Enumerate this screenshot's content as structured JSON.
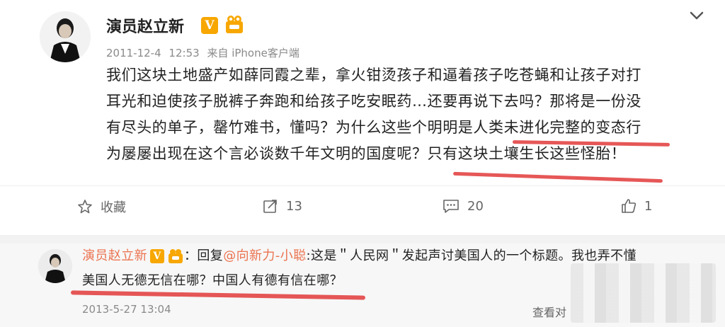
{
  "post": {
    "username": "演员赵立新",
    "verified_badge": "V",
    "level_icon": "level-badge-icon",
    "menu_icon": "chevron-down-icon",
    "date": "2011-12-4",
    "time": "12:53",
    "source": "来自 iPhone客户端",
    "content_lines": [
      "我们这块土地盛产如薛同霞之辈，拿火钳烫孩子和逼着孩子吃苍蝇和让孩子对打",
      "耳光和迫使孩子脱裤子奔跑和给孩子吃安眠药…还要再说下去吗？那将是一份没",
      "有尽头的单子，罄竹难书，懂吗？为什么这些个明明是人类未进化完整的变态行",
      "为屡屡出现在这个言必谈数千年文明的国度呢？只有这块土壤生长这些怪胎！"
    ],
    "highlight_color": "#e23a3a"
  },
  "actions": {
    "favorite_label": "收藏",
    "repost_count": "13",
    "comment_count": "20",
    "like_count": "1"
  },
  "comment": {
    "name": "演员赵立新",
    "verified_badge": "V",
    "separator": "：回复",
    "mention": "@向新力-小聪",
    "text_part1": ":这是＂人民网＂发起声讨美国人的一个标题。我也弄不懂",
    "text_line2": "美国人无德无信在哪？中国人有德有信在哪？",
    "timestamp": "2013-5-27 13:04",
    "reply_link": "查看对"
  },
  "colors": {
    "accent": "#eb7350",
    "badge": "#f7a700",
    "underline": "#e23a3a"
  }
}
